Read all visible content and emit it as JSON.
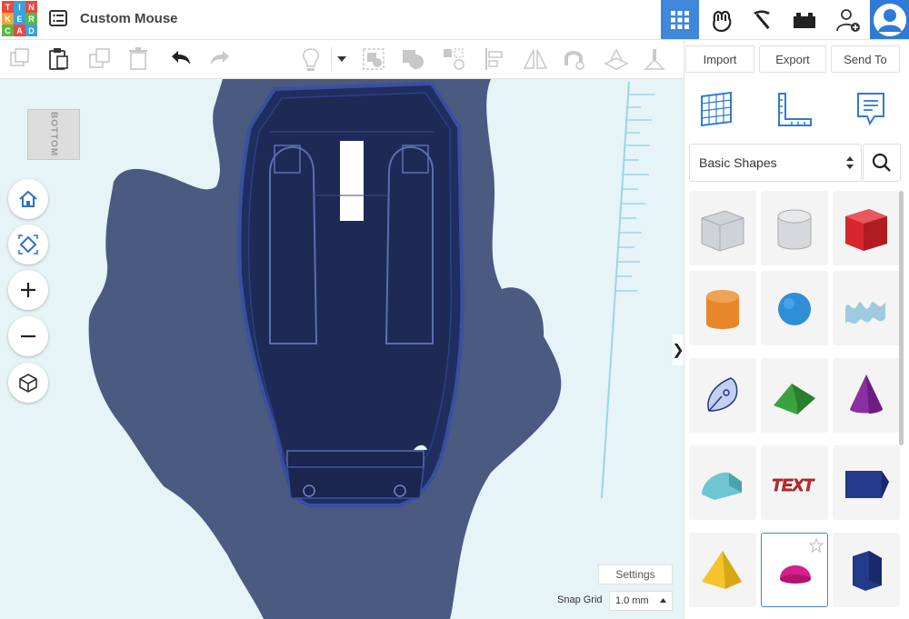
{
  "app": {
    "logo_letters": [
      "T",
      "I",
      "N",
      "K",
      "E",
      "R",
      "C",
      "A",
      "D"
    ],
    "logo_colors": [
      "#e84a3f",
      "#3aa0de",
      "#e84a3f",
      "#f4a53a",
      "#3aa0de",
      "#58b947",
      "#58b947",
      "#e84a3f",
      "#3aa0de"
    ],
    "document_title": "Custom Mouse"
  },
  "top_right": {
    "icons": [
      "grid-view-icon",
      "sim-lab-icon",
      "minecraft-pickaxe-icon",
      "bricks-icon",
      "user-invite-icon",
      "avatar-icon"
    ],
    "active_color": "#3f87d9"
  },
  "toolbar": {
    "icons": [
      "copy-icon",
      "paste-icon",
      "duplicate-icon",
      "delete-icon",
      "undo-icon",
      "redo-icon",
      "light-bulb-icon",
      "caret-down-icon",
      "group-icon",
      "solid-hole-icon",
      "ungroup-icon",
      "align-icon",
      "mirror-icon",
      "magnet-icon",
      "workplane-icon",
      "ruler-icon"
    ]
  },
  "actions": {
    "import_label": "Import",
    "export_label": "Export",
    "send_label": "Send To"
  },
  "view_cube": {
    "face_label": "BOTTOM"
  },
  "nav_controls": [
    "home-icon",
    "fit-view-icon",
    "zoom-in-icon",
    "zoom-out-icon",
    "perspective-icon"
  ],
  "panel": {
    "tab_icons": [
      "grid-icon",
      "ruler-icon",
      "notes-icon"
    ],
    "category_select": "Basic Shapes",
    "collapse_glyph": "❯",
    "shapes": [
      {
        "name": "box-hole",
        "color": "#cfd3d8"
      },
      {
        "name": "cylinder-hole",
        "color": "#d6d8db"
      },
      {
        "name": "box",
        "color": "#d8262d"
      },
      {
        "name": "cylinder",
        "color": "#e8862a"
      },
      {
        "name": "sphere",
        "color": "#2e8fd6"
      },
      {
        "name": "scribble",
        "color": "#9fcbe0"
      },
      {
        "name": "shape-generator",
        "color": "#a9b6e0"
      },
      {
        "name": "roof",
        "color": "#3aa33f"
      },
      {
        "name": "cone",
        "color": "#8b2fa3"
      },
      {
        "name": "round-roof",
        "color": "#6fc6d0"
      },
      {
        "name": "text",
        "color": "#d42a2a"
      },
      {
        "name": "wedge",
        "color": "#23398a"
      },
      {
        "name": "pyramid",
        "color": "#f3c52b"
      },
      {
        "name": "half-sphere",
        "color": "#d61f8c"
      },
      {
        "name": "polygon",
        "color": "#23398a"
      }
    ]
  },
  "workplane": {
    "settings_label": "Settings",
    "snap_grid_label": "Snap Grid",
    "snap_grid_value": "1.0 mm",
    "background": "#e6f3f7",
    "shadow_color": "#4a5a80",
    "mouse_body_color": "#1f2e5e",
    "mouse_outline_color": "#3a4fa0"
  }
}
